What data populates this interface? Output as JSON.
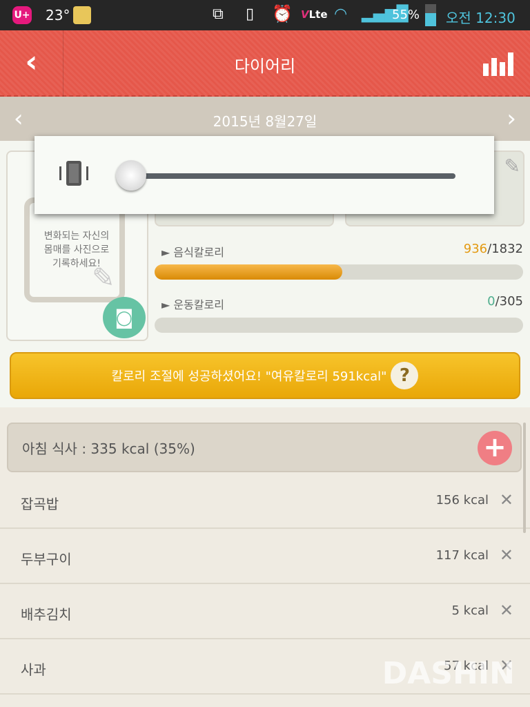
{
  "status_bar": {
    "carrier": "U+",
    "temperature": "23°",
    "battery": "55%",
    "time": "오전 12:30",
    "icons": [
      "lg-uplus-icon",
      "weather-icon",
      "screen-mirror-icon",
      "vibrate-icon",
      "alarm-icon",
      "volte-icon",
      "wifi-lock-icon",
      "signal-icon",
      "battery-icon"
    ]
  },
  "header": {
    "title": "다이어리",
    "back_icon": "chevron-left-icon",
    "chart_icon": "bar-chart-icon"
  },
  "date_bar": {
    "date": "2015년 8월27일"
  },
  "photo_card": {
    "text_lines": [
      "변화되는 자신의",
      "몸매를 사진으로",
      "기록하세요!"
    ]
  },
  "calories": {
    "food_label": "음식칼로리",
    "food_value": "936",
    "food_total": "/1832",
    "food_progress": 0.51,
    "exercise_label": "운동칼로리",
    "exercise_value": "0",
    "exercise_total": "/305",
    "exercise_progress": 0
  },
  "banner": {
    "text": "칼로리 조절에 성공하셨어요! \"여유칼로리 591kcal\"",
    "help": "?"
  },
  "meal": {
    "header": "아침 식사 : 335 kcal (35%)",
    "items": [
      {
        "name": "잡곡밥",
        "kcal": "156 kcal"
      },
      {
        "name": "두부구이",
        "kcal": "117 kcal"
      },
      {
        "name": "배추김치",
        "kcal": "5 kcal"
      },
      {
        "name": "사과",
        "kcal": "57 kcal"
      }
    ]
  },
  "volume_popup": {
    "level": 0,
    "mode": "vibrate"
  },
  "watermark": "DASHIN",
  "colors": {
    "header": "#e5574a",
    "accent_orange": "#e39a12",
    "accent_green": "#4fae8e",
    "banner": "#f2b91d"
  }
}
